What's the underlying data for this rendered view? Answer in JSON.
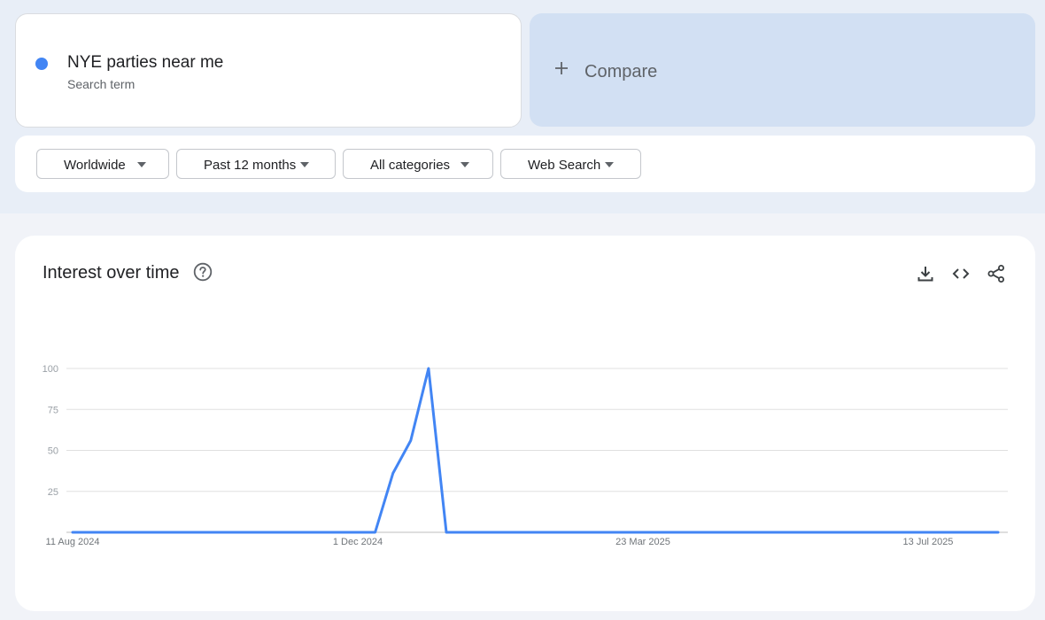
{
  "search_term": {
    "name": "NYE parties near me",
    "subtitle": "Search term",
    "color": "#4285f4"
  },
  "compare": {
    "label": "Compare",
    "icon": "plus-icon"
  },
  "filters": [
    {
      "label": "Worldwide"
    },
    {
      "label": "Past 12 months"
    },
    {
      "label": "All categories"
    },
    {
      "label": "Web Search"
    }
  ],
  "chart_card": {
    "title": "Interest over time",
    "icons": [
      "help-icon",
      "download-icon",
      "embed-code-icon",
      "share-icon"
    ]
  },
  "chart_data": {
    "type": "line",
    "title": "",
    "xlabel": "",
    "ylabel": "",
    "ylim": [
      0,
      100
    ],
    "yticks": [
      25,
      50,
      75,
      100
    ],
    "x_tick_labels": [
      "11 Aug 2024",
      "1 Dec 2024",
      "23 Mar 2025",
      "13 Jul 2025"
    ],
    "x_range": [
      "2024-08-11",
      "2025-08-10"
    ],
    "grid": true,
    "series": [
      {
        "color": "#4285f4",
        "x": [
          "2024-08-11",
          "2024-08-18",
          "2024-08-25",
          "2024-09-01",
          "2024-09-08",
          "2024-09-15",
          "2024-09-22",
          "2024-09-29",
          "2024-10-06",
          "2024-10-13",
          "2024-10-20",
          "2024-10-27",
          "2024-11-03",
          "2024-11-10",
          "2024-11-17",
          "2024-11-24",
          "2024-12-01",
          "2024-12-08",
          "2024-12-15",
          "2024-12-22",
          "2024-12-29",
          "2025-01-05",
          "2025-01-12",
          "2025-01-19",
          "2025-01-26",
          "2025-02-02",
          "2025-02-09",
          "2025-02-16",
          "2025-02-23",
          "2025-03-02",
          "2025-03-09",
          "2025-03-16",
          "2025-03-23",
          "2025-03-30",
          "2025-04-06",
          "2025-04-13",
          "2025-04-20",
          "2025-04-27",
          "2025-05-04",
          "2025-05-11",
          "2025-05-18",
          "2025-05-25",
          "2025-06-01",
          "2025-06-08",
          "2025-06-15",
          "2025-06-22",
          "2025-06-29",
          "2025-07-06",
          "2025-07-13",
          "2025-07-20",
          "2025-07-27",
          "2025-08-03",
          "2025-08-10"
        ],
        "values": [
          0,
          0,
          0,
          0,
          0,
          0,
          0,
          0,
          0,
          0,
          0,
          0,
          0,
          0,
          0,
          0,
          0,
          0,
          36,
          56,
          100,
          0,
          0,
          0,
          0,
          0,
          0,
          0,
          0,
          0,
          0,
          0,
          0,
          0,
          0,
          0,
          0,
          0,
          0,
          0,
          0,
          0,
          0,
          0,
          0,
          0,
          0,
          0,
          0,
          0,
          0,
          0,
          0
        ]
      }
    ]
  }
}
